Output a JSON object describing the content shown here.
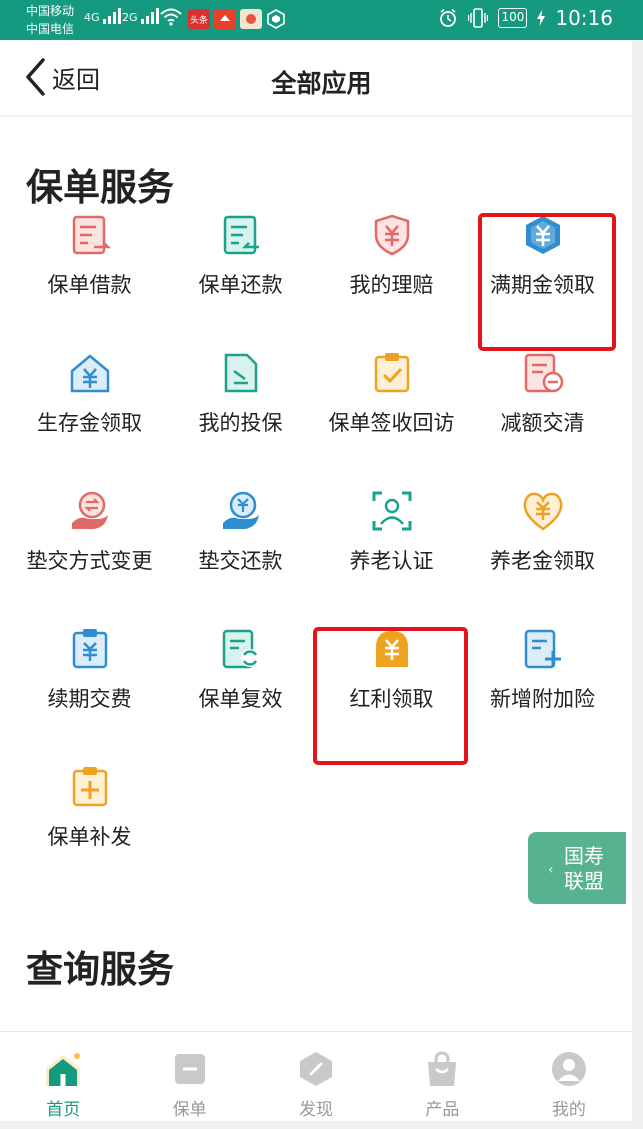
{
  "status_bar": {
    "carrier1": "中国移动",
    "carrier2": "中国电信",
    "net1": "4G",
    "net2": "2G",
    "badge_toutiao": "头条",
    "battery": "100",
    "time": "10:16"
  },
  "header": {
    "back_label": "返回",
    "title": "全部应用"
  },
  "sections": {
    "policy_service_title": "保单服务",
    "query_service_title": "查询服务"
  },
  "apps": [
    {
      "label": "保单借款",
      "icon": "policy-loan-icon",
      "color": "#e26a66"
    },
    {
      "label": "保单还款",
      "icon": "policy-repay-icon",
      "color": "#1aa28c"
    },
    {
      "label": "我的理赔",
      "icon": "claim-shield-icon",
      "color": "#e26a66"
    },
    {
      "label": "满期金领取",
      "icon": "maturity-hexagon-icon",
      "color": "#2e8ecf"
    },
    {
      "label": "生存金领取",
      "icon": "survival-house-icon",
      "color": "#2e8ecf"
    },
    {
      "label": "我的投保",
      "icon": "my-insure-doc-icon",
      "color": "#1aa28c"
    },
    {
      "label": "保单签收回访",
      "icon": "sign-clipboard-icon",
      "color": "#eea320"
    },
    {
      "label": "减额交清",
      "icon": "reduce-doc-icon",
      "color": "#e26a66"
    },
    {
      "label": "垫交方式变更",
      "icon": "advance-change-icon",
      "color": "#e26a66"
    },
    {
      "label": "垫交还款",
      "icon": "advance-repay-icon",
      "color": "#2e8ecf"
    },
    {
      "label": "养老认证",
      "icon": "face-scan-icon",
      "color": "#1aa28c"
    },
    {
      "label": "养老金领取",
      "icon": "pension-heart-icon",
      "color": "#eea320"
    },
    {
      "label": "续期交费",
      "icon": "renewal-clipboard-icon",
      "color": "#2e8ecf"
    },
    {
      "label": "保单复效",
      "icon": "reinstate-doc-icon",
      "color": "#1aa28c"
    },
    {
      "label": "红利领取",
      "icon": "dividend-arch-icon",
      "color": "#eea320"
    },
    {
      "label": "新增附加险",
      "icon": "add-rider-icon",
      "color": "#2e8ecf"
    },
    {
      "label": "保单补发",
      "icon": "reissue-clipboard-icon",
      "color": "#eea320"
    }
  ],
  "float_button": {
    "line1": "国寿",
    "line2": "联盟"
  },
  "bottom_nav": [
    {
      "label": "首页",
      "active": true
    },
    {
      "label": "保单",
      "active": false
    },
    {
      "label": "发现",
      "active": false
    },
    {
      "label": "产品",
      "active": false
    },
    {
      "label": "我的",
      "active": false
    }
  ],
  "colors": {
    "brand": "#159a80",
    "highlight": "#e4141d",
    "float_button": "#57b38f"
  }
}
